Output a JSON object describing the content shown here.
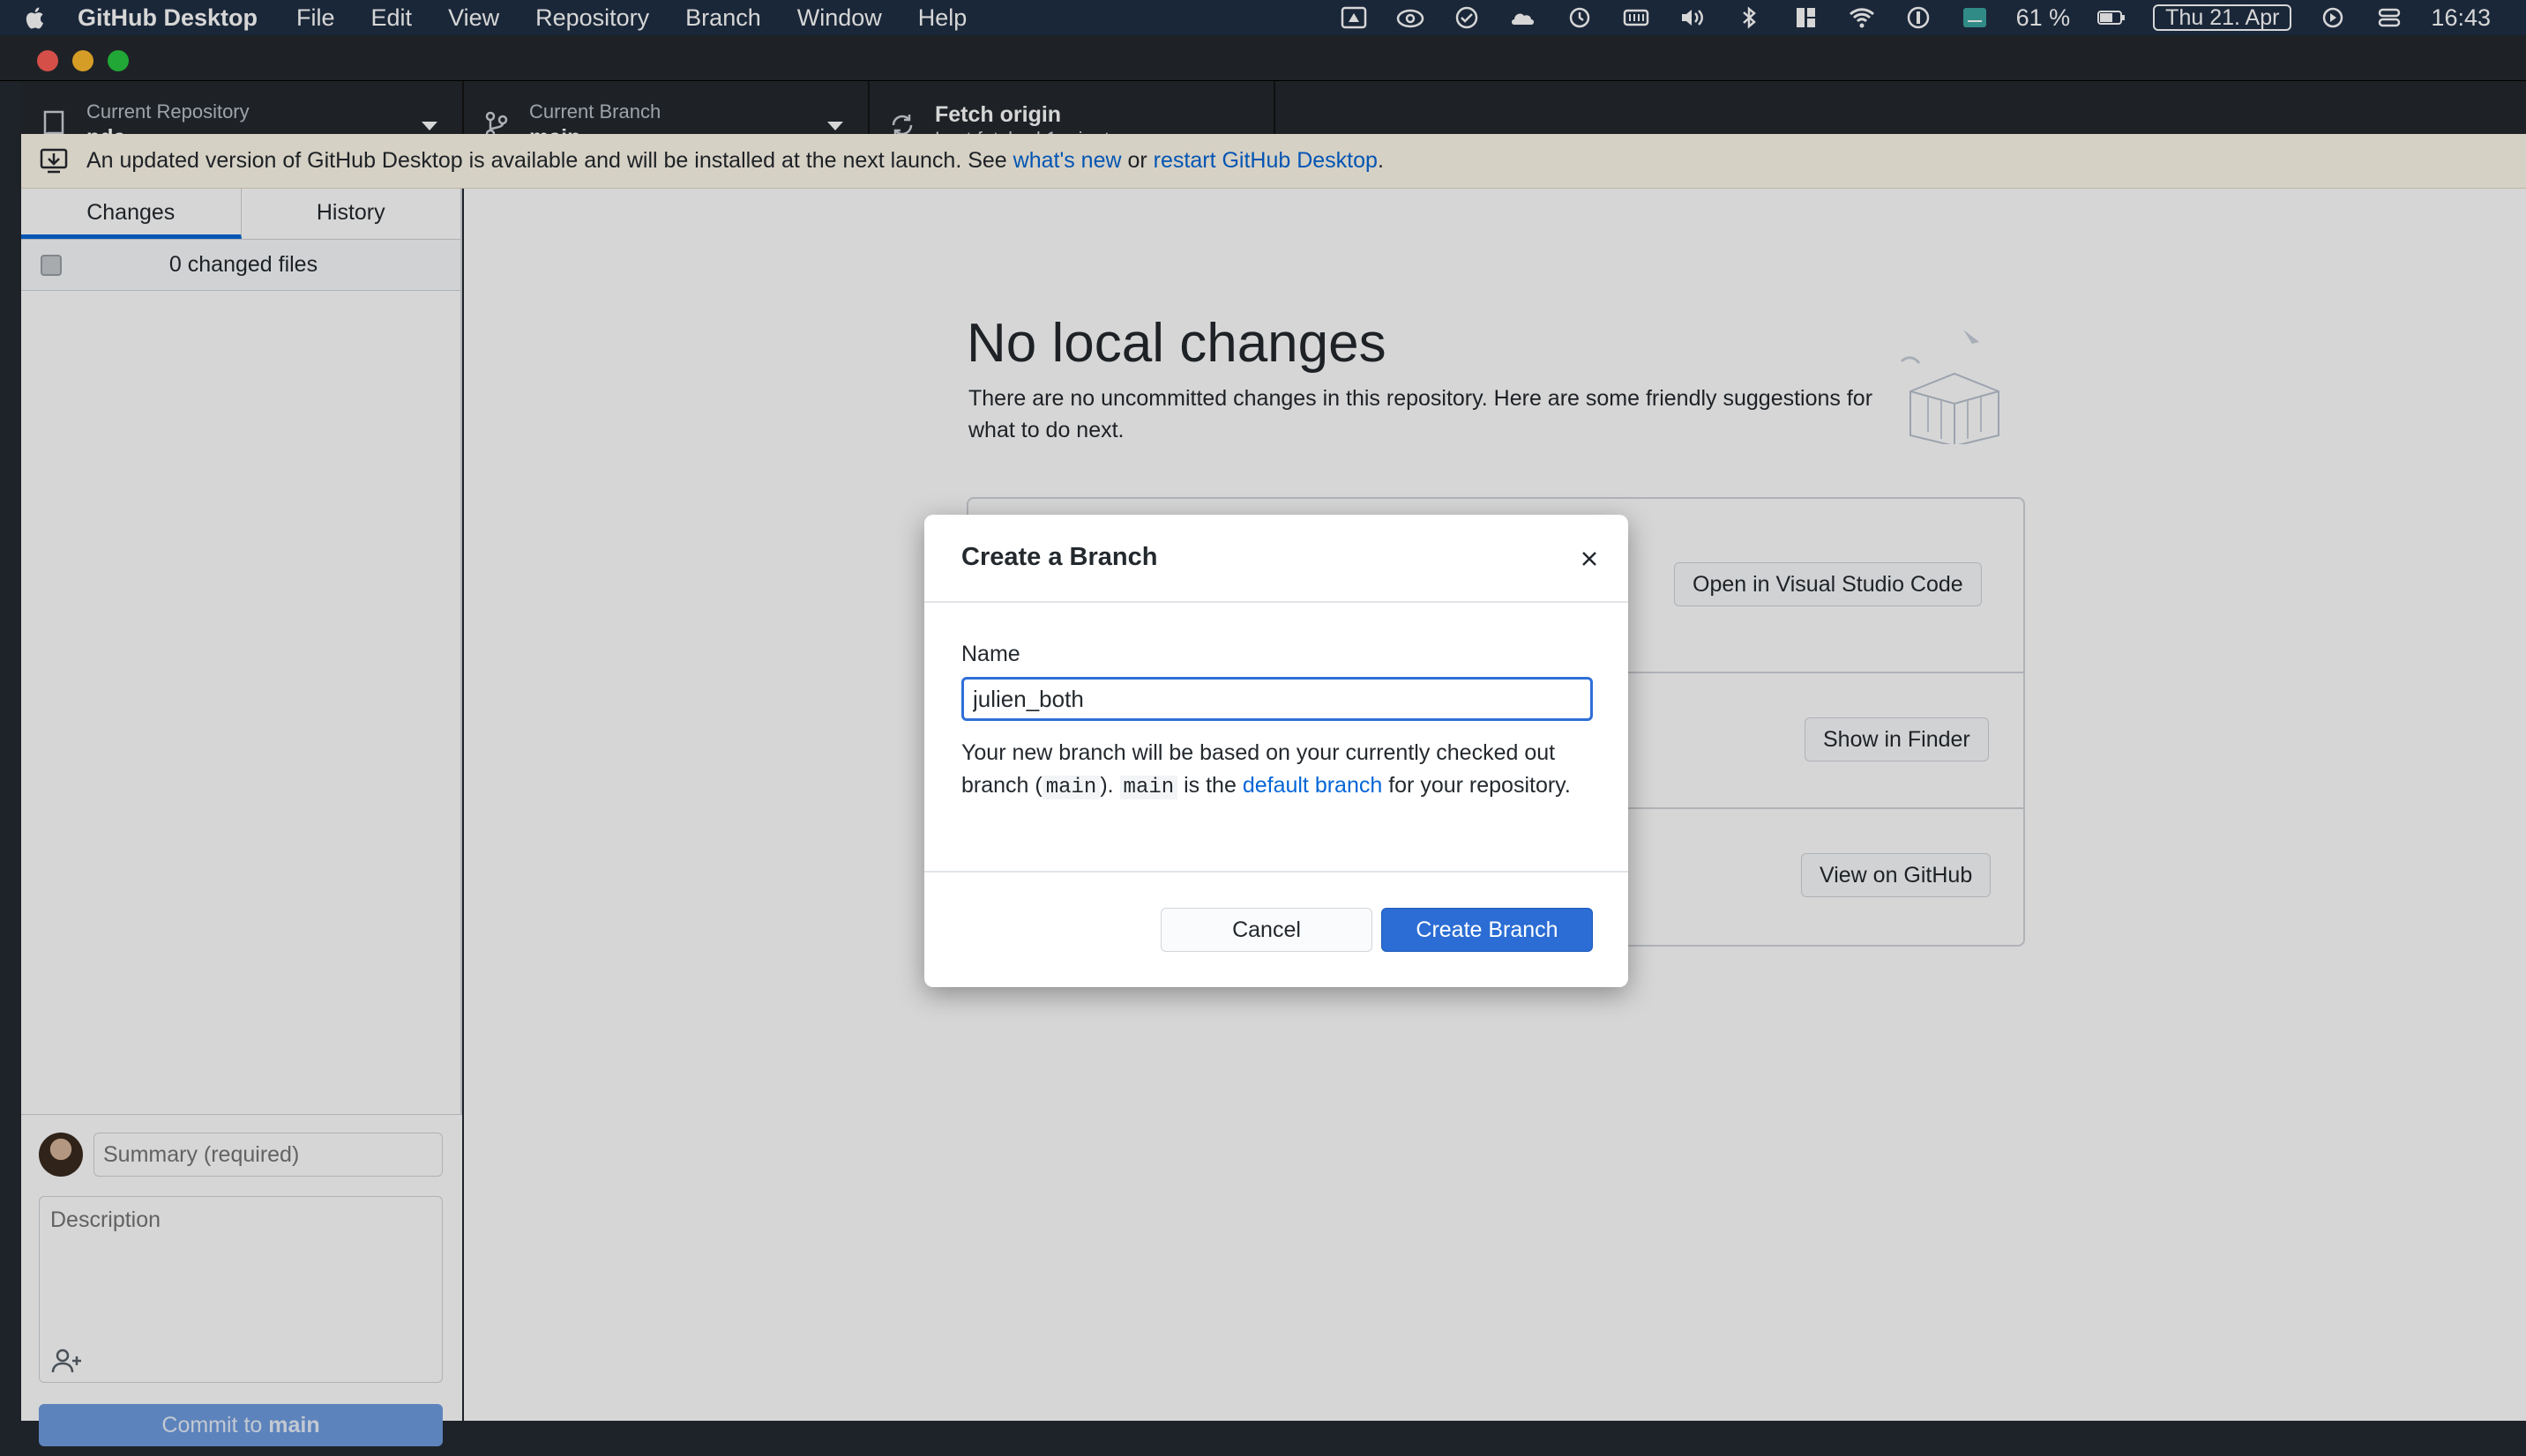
{
  "menubar": {
    "app_name": "GitHub Desktop",
    "items": [
      "File",
      "Edit",
      "View",
      "Repository",
      "Branch",
      "Window",
      "Help"
    ],
    "battery": "61 %",
    "date": "Thu 21. Apr",
    "time": "16:43"
  },
  "toolbar": {
    "repo_label": "Current Repository",
    "repo_value": "pda",
    "branch_label": "Current Branch",
    "branch_value": "main",
    "fetch_title": "Fetch origin",
    "fetch_sub": "Last fetched 1 minute ago"
  },
  "banner": {
    "text": "An updated version of GitHub Desktop is available and will be installed at the next launch. See ",
    "link1": "what's new",
    "middle": " or ",
    "link2": "restart GitHub Desktop",
    "end": "."
  },
  "sidebar": {
    "tabs": [
      "Changes",
      "History"
    ],
    "changed_files": "0 changed files",
    "summary_placeholder": "Summary (required)",
    "description_placeholder": "Description",
    "commit_prefix": "Commit to ",
    "commit_branch": "main"
  },
  "main": {
    "title": "No local changes",
    "text": "There are no uncommitted changes in this repository. Here are some friendly suggestions for what to do next.",
    "buttons": [
      "Open in Visual Studio Code",
      "Show in Finder",
      "View on GitHub"
    ]
  },
  "modal": {
    "title": "Create a Branch",
    "name_label": "Name",
    "name_value": "julien_both",
    "info_1": "Your new branch will be based on your currently checked out branch (",
    "code_1": "main",
    "info_2": "). ",
    "code_2": "main",
    "info_3": " is the ",
    "link": "default branch",
    "info_4": " for your repository.",
    "cancel": "Cancel",
    "create": "Create Branch"
  },
  "colors": {
    "accent": "#2b6dd4",
    "toolbar_bg": "#24292e",
    "banner_bg": "#fff9eb"
  }
}
